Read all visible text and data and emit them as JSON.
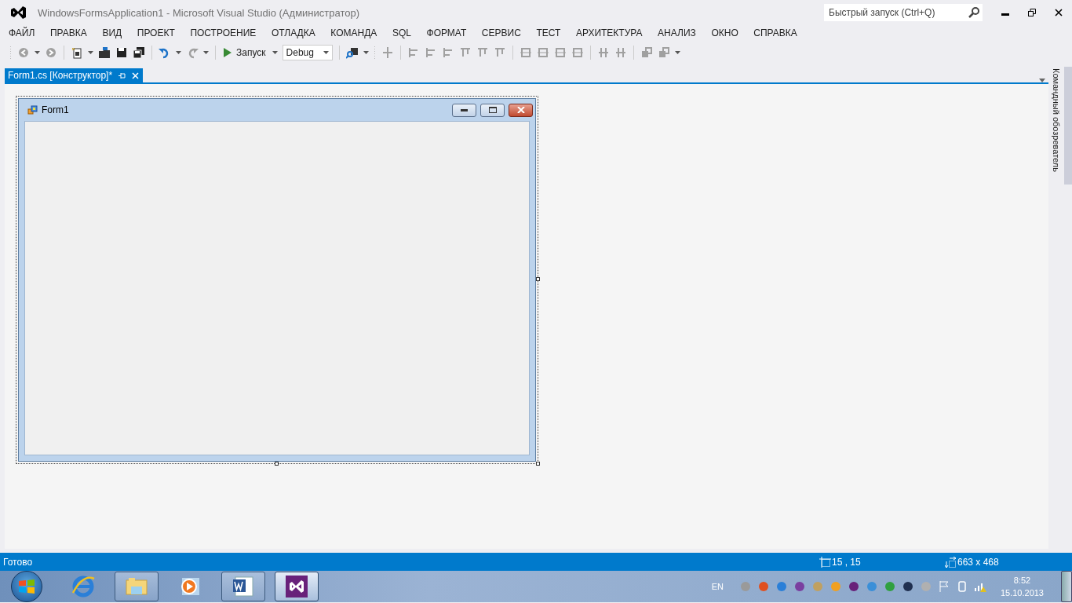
{
  "window": {
    "title": "WindowsFormsApplication1 - Microsoft Visual Studio (Администратор)"
  },
  "quick_launch": {
    "placeholder": "Быстрый запуск (Ctrl+Q)"
  },
  "menu": [
    "ФАЙЛ",
    "ПРАВКА",
    "ВИД",
    "ПРОЕКТ",
    "ПОСТРОЕНИЕ",
    "ОТЛАДКА",
    "КОМАНДА",
    "SQL",
    "ФОРМАТ",
    "СЕРВИС",
    "ТЕСТ",
    "АРХИТЕКТУРА",
    "АНАЛИЗ",
    "ОКНО",
    "СПРАВКА"
  ],
  "toolbar": {
    "run_label": "Запуск",
    "configuration": "Debug"
  },
  "tabs": [
    {
      "label": "Form1.cs [Конструктор]*",
      "selected": true
    }
  ],
  "designer": {
    "form_title": "Form1"
  },
  "side_panel": {
    "label": "Командный обозреватель"
  },
  "status_bar": {
    "text": "Готово",
    "location": "15 , 15",
    "size": "663 x 468"
  },
  "taskbar": {
    "apps": [
      {
        "kind": "ie",
        "running": false,
        "selected": false
      },
      {
        "kind": "explorer",
        "running": true,
        "selected": false
      },
      {
        "kind": "media",
        "running": false,
        "selected": false
      },
      {
        "kind": "word",
        "running": true,
        "selected": false
      },
      {
        "kind": "vs",
        "running": true,
        "selected": true
      }
    ],
    "language": "EN",
    "time": "8:52",
    "date": "15.10.2013"
  }
}
